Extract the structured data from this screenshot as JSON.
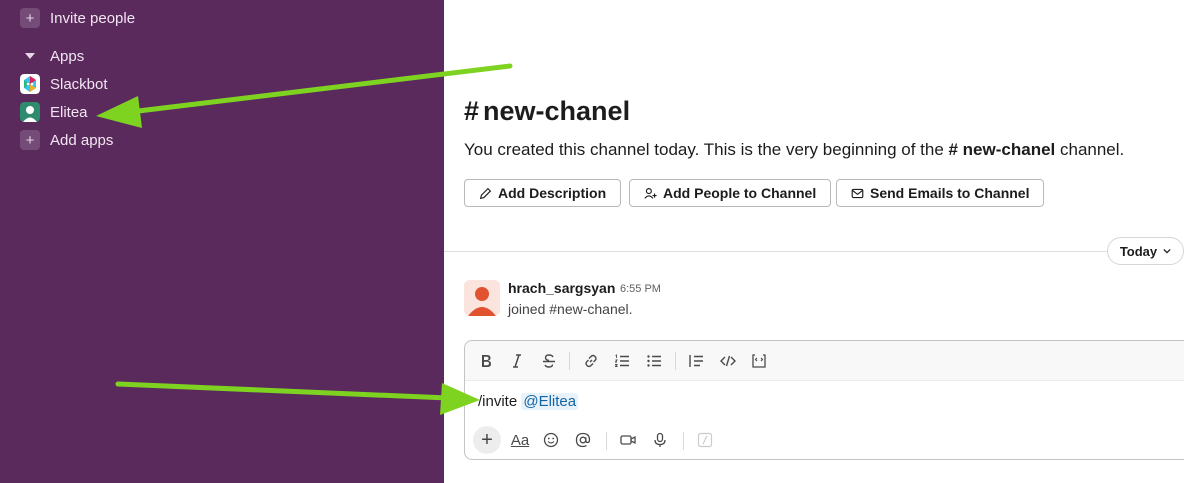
{
  "sidebar": {
    "invite_label": "Invite people",
    "apps_section_label": "Apps",
    "apps": [
      {
        "label": "Slackbot",
        "icon": "slackbot-icon"
      },
      {
        "label": "Elitea",
        "icon": "elitea-app-icon"
      }
    ],
    "add_apps_label": "Add apps"
  },
  "channel": {
    "hash": "#",
    "name": "new-chanel",
    "intro_prefix": "You created this channel today. This is the very beginning of the ",
    "intro_channel": "# new-chanel",
    "intro_suffix": " channel.",
    "actions": {
      "add_description": "Add Description",
      "add_people": "Add People to Channel",
      "send_emails": "Send Emails to Channel"
    }
  },
  "date_divider": {
    "label": "Today"
  },
  "message": {
    "author": "hrach_sargsyan",
    "time": "6:55 PM",
    "text": "joined #new-chanel."
  },
  "composer": {
    "command": "/invite ",
    "mention": "@Elitea",
    "format_tools": [
      "bold-icon",
      "italic-icon",
      "strikethrough-icon",
      "link-icon",
      "ordered-list-icon",
      "bulleted-list-icon",
      "blockquote-icon",
      "code-icon",
      "code-block-icon"
    ],
    "bottom_tools": [
      "plus-icon",
      "text-format-icon",
      "emoji-icon",
      "mention-icon",
      "video-icon",
      "microphone-icon",
      "slash-shortcut-icon"
    ],
    "format_label": "Aa"
  },
  "colors": {
    "sidebar_bg": "#5b2a5d",
    "annotation_arrow": "#7ed321",
    "mention_bg": "#e8f2fb",
    "mention_text": "#1264a3"
  }
}
